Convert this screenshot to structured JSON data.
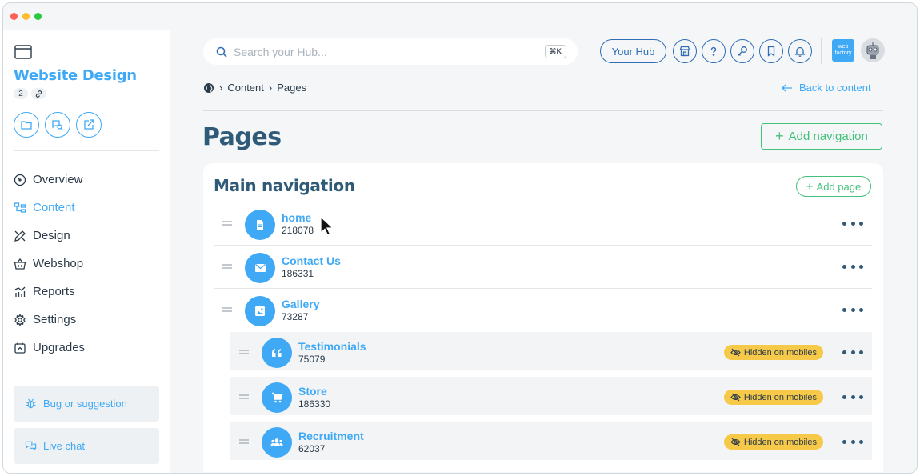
{
  "window": {
    "controls": [
      "close",
      "minimize",
      "maximize"
    ]
  },
  "sidebar": {
    "site_title": "Website Design",
    "meta_count": "2",
    "quick_actions": [
      {
        "icon": "folder-icon"
      },
      {
        "icon": "chat-search-icon"
      },
      {
        "icon": "external-link-icon"
      }
    ],
    "nav": [
      {
        "label": "Overview",
        "icon": "gauge-icon",
        "active": false
      },
      {
        "label": "Content",
        "icon": "sitemap-icon",
        "active": true
      },
      {
        "label": "Design",
        "icon": "design-tools-icon",
        "active": false
      },
      {
        "label": "Webshop",
        "icon": "basket-icon",
        "active": false
      },
      {
        "label": "Reports",
        "icon": "chart-icon",
        "active": false
      },
      {
        "label": "Settings",
        "icon": "gear-icon",
        "active": false
      },
      {
        "label": "Upgrades",
        "icon": "upgrade-icon",
        "active": false
      }
    ],
    "bug_label": "Bug or suggestion",
    "chat_label": "Live chat"
  },
  "header": {
    "search_placeholder": "Search your Hub...",
    "search_shortcut": "⌘K",
    "hub_label": "Your Hub",
    "icons": [
      "store-icon",
      "help-icon",
      "key-icon",
      "bookmark-icon",
      "bell-icon"
    ],
    "logo_text": "web factory"
  },
  "breadcrumb": {
    "items": [
      "Content",
      "Pages"
    ]
  },
  "back_label": "Back to content",
  "page_title": "Pages",
  "add_navigation_label": "Add navigation",
  "panel": {
    "title": "Main navigation",
    "add_page_label": "Add page",
    "rows": [
      {
        "name": "home",
        "id": "218078",
        "icon": "document-icon",
        "child": false,
        "hidden_mobile": false
      },
      {
        "name": "Contact Us",
        "id": "186331",
        "icon": "envelope-icon",
        "child": false,
        "hidden_mobile": false
      },
      {
        "name": "Gallery",
        "id": "73287",
        "icon": "image-icon",
        "child": false,
        "hidden_mobile": false
      },
      {
        "name": "Testimonials",
        "id": "75079",
        "icon": "quote-icon",
        "child": true,
        "hidden_mobile": true
      },
      {
        "name": "Store",
        "id": "186330",
        "icon": "cart-icon",
        "child": true,
        "hidden_mobile": true
      },
      {
        "name": "Recruitment",
        "id": "62037",
        "icon": "users-icon",
        "child": true,
        "hidden_mobile": true
      }
    ],
    "hidden_label": "Hidden on mobiles"
  },
  "colors": {
    "accent": "#3fa9f5",
    "heading": "#2f5b78",
    "green": "#43c17a",
    "badge": "#f7c948",
    "dark_blue": "#2f6db5"
  }
}
